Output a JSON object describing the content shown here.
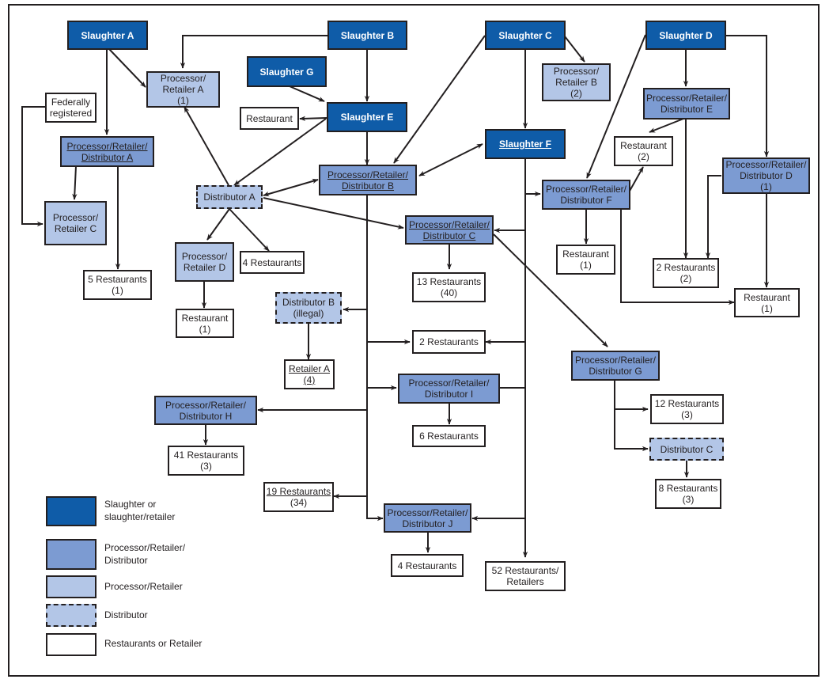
{
  "colors": {
    "slaughter": "#0f5ca8",
    "processor_retailer_distributor": "#7c9bd2",
    "processor_retailer": "#b3c6e7",
    "distributor": "#b3c6e7",
    "restaurant": "#ffffff",
    "line": "#231f20"
  },
  "nodes": {
    "slaughter_a": {
      "line1": "Slaughter A",
      "type": "slaughter"
    },
    "slaughter_b": {
      "line1": "Slaughter B",
      "type": "slaughter"
    },
    "slaughter_c": {
      "line1": "Slaughter C",
      "type": "slaughter"
    },
    "slaughter_d": {
      "line1": "Slaughter D",
      "type": "slaughter"
    },
    "slaughter_e": {
      "line1": "Slaughter E",
      "type": "slaughter"
    },
    "slaughter_f": {
      "line1": "Slaughter F",
      "type": "slaughter",
      "underlined": true
    },
    "slaughter_g": {
      "line1": "Slaughter G",
      "type": "slaughter"
    },
    "pr_a": {
      "line1": "Processor/",
      "line2": "Retailer A",
      "line3": "(1)",
      "type": "processor_retailer"
    },
    "pr_b": {
      "line1": "Processor/",
      "line2": "Retailer B",
      "line3": "(2)",
      "type": "processor_retailer"
    },
    "pr_c": {
      "line1": "Processor/",
      "line2": "Retailer C",
      "type": "processor_retailer"
    },
    "pr_d": {
      "line1": "Processor/",
      "line2": "Retailer D",
      "type": "processor_retailer"
    },
    "prd_a": {
      "line1": "Processor/Retailer/",
      "line2": "Distributor A",
      "type": "processor_retailer_distributor",
      "underlined": true
    },
    "prd_b": {
      "line1": "Processor/Retailer/",
      "line2": "Distributor B",
      "type": "processor_retailer_distributor",
      "underlined": true
    },
    "prd_c": {
      "line1": "Processor/Retailer/",
      "line2": "Distributor C",
      "type": "processor_retailer_distributor",
      "underlined": true
    },
    "prd_d": {
      "line1": "Processor/Retailer/",
      "line2": "Distributor D",
      "line3": "(1)",
      "type": "processor_retailer_distributor"
    },
    "prd_e": {
      "line1": "Processor/Retailer/",
      "line2": "Distributor E",
      "type": "processor_retailer_distributor"
    },
    "prd_f": {
      "line1": "Processor/Retailer/",
      "line2": "Distributor F",
      "type": "processor_retailer_distributor"
    },
    "prd_g": {
      "line1": "Processor/Retailer/",
      "line2": "Distributor G",
      "type": "processor_retailer_distributor"
    },
    "prd_h": {
      "line1": "Processor/Retailer/",
      "line2": "Distributor H",
      "type": "processor_retailer_distributor"
    },
    "prd_i": {
      "line1": "Processor/Retailer/",
      "line2": "Distributor I",
      "type": "processor_retailer_distributor"
    },
    "prd_j": {
      "line1": "Processor/Retailer/",
      "line2": "Distributor J",
      "type": "processor_retailer_distributor"
    },
    "dist_a": {
      "line1": "Distributor A",
      "type": "distributor"
    },
    "dist_b": {
      "line1": "Distributor B",
      "line2": "(illegal)",
      "type": "distributor"
    },
    "dist_c": {
      "line1": "Distributor C",
      "type": "distributor"
    },
    "federally_registered": {
      "line1": "Federally",
      "line2": "registered",
      "type": "restaurant"
    },
    "rest_e": {
      "line1": "Restaurant",
      "type": "restaurant"
    },
    "rest_e2": {
      "line1": "Restaurant",
      "line2": "(2)",
      "type": "restaurant"
    },
    "rest_f1": {
      "line1": "Restaurant",
      "line2": "(1)",
      "type": "restaurant"
    },
    "rest_d1": {
      "line1": "Restaurant",
      "line2": "(1)",
      "type": "restaurant"
    },
    "rest_prd1": {
      "line1": "Restaurant",
      "line2": "(1)",
      "type": "restaurant"
    },
    "rest_5": {
      "line1": "5 Restaurants",
      "line2": "(1)",
      "type": "restaurant"
    },
    "rest_4a": {
      "line1": "4 Restaurants",
      "type": "restaurant"
    },
    "rest_13": {
      "line1": "13 Restaurants",
      "line2": "(40)",
      "type": "restaurant"
    },
    "rest_2a": {
      "line1": "2 Restaurants",
      "line2": "(2)",
      "type": "restaurant"
    },
    "rest_2b": {
      "line1": "2 Restaurants",
      "type": "restaurant"
    },
    "retailer_a": {
      "line1": "Retailer A",
      "line2": "(4)",
      "type": "restaurant",
      "underlined": true
    },
    "rest_6": {
      "line1": "6 Restaurants",
      "type": "restaurant"
    },
    "rest_41": {
      "line1": "41 Restaurants",
      "line2": "(3)",
      "type": "restaurant"
    },
    "rest_12": {
      "line1": "12 Restaurants",
      "line2": "(3)",
      "type": "restaurant"
    },
    "rest_8": {
      "line1": "8 Restaurants",
      "line2": "(3)",
      "type": "restaurant"
    },
    "rest_19": {
      "line1": "19 Restaurants",
      "line2": "(34)",
      "type": "restaurant",
      "underlined_line1": true
    },
    "rest_4b": {
      "line1": "4 Restaurants",
      "type": "restaurant"
    },
    "rest_52": {
      "line1": "52 Restaurants/",
      "line2": "Retailers",
      "type": "restaurant"
    }
  },
  "legend": [
    {
      "type": "slaughter",
      "line1": "Slaughter or",
      "line2": "slaughter/retailer"
    },
    {
      "type": "processor_retailer_distributor",
      "line1": "Processor/Retailer/",
      "line2": "Distributor"
    },
    {
      "type": "processor_retailer",
      "line1": "Processor/Retailer"
    },
    {
      "type": "distributor",
      "line1": "Distributor"
    },
    {
      "type": "restaurant",
      "line1": "Restaurants or Retailer"
    }
  ]
}
